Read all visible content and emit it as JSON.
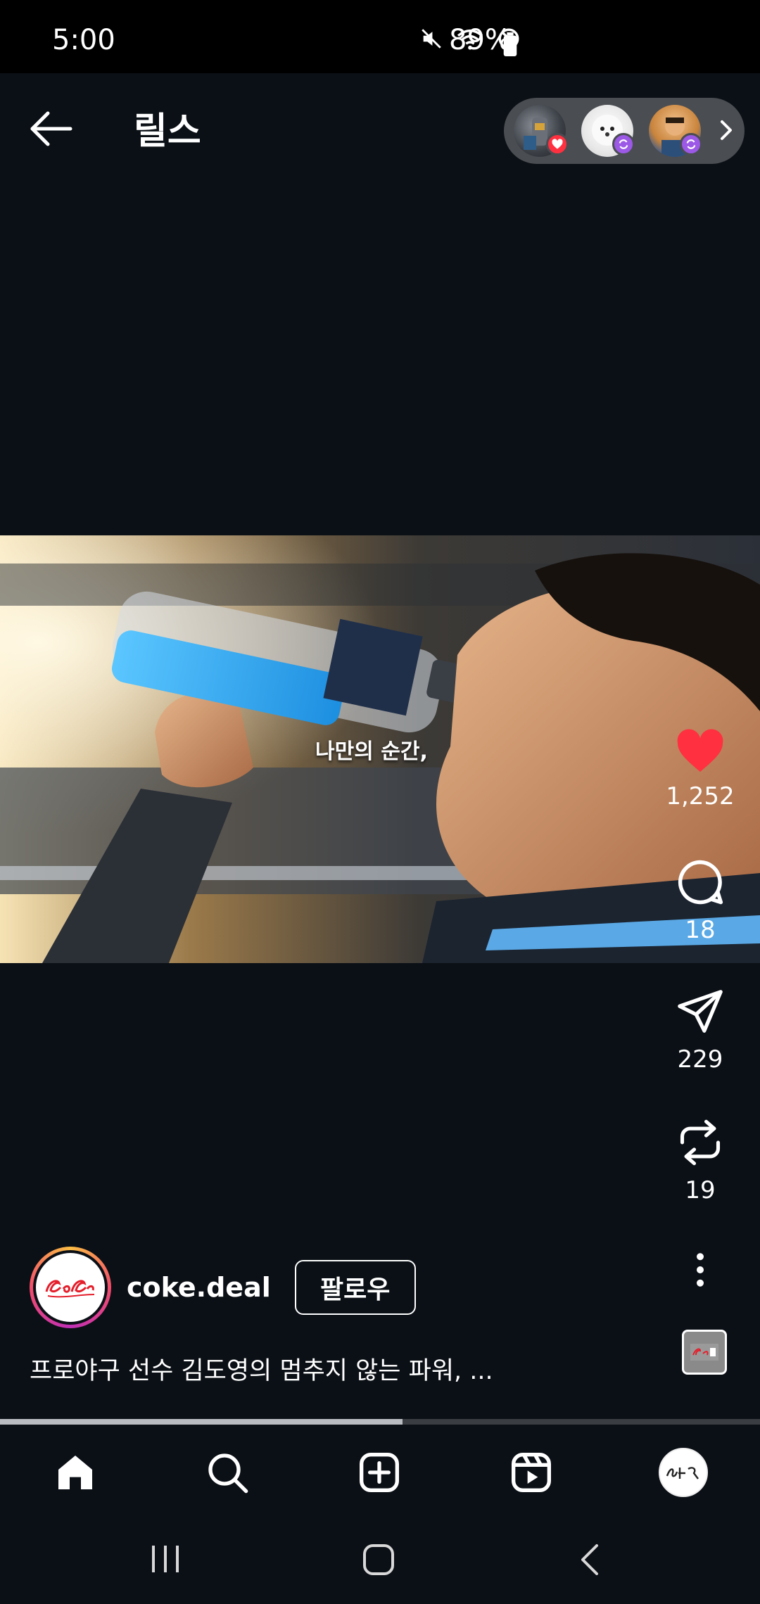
{
  "status_bar": {
    "time": "5:00",
    "battery_percent": "89%",
    "icons": [
      "mute-icon",
      "wifi-icon",
      "do-not-disturb-icon",
      "battery-icon"
    ]
  },
  "header": {
    "title": "릴스",
    "back_icon": "arrow-left-icon",
    "friends_pill": {
      "avatars": [
        "friend-avatar-1",
        "friend-avatar-2",
        "friend-avatar-3"
      ],
      "badges": [
        "heart-badge",
        "repost-badge",
        "repost-badge"
      ],
      "chevron_icon": "chevron-right-icon"
    }
  },
  "video": {
    "caption": "나만의 순간,"
  },
  "actions": {
    "like": {
      "icon": "heart-icon",
      "count": "1,252",
      "color": "#ff3040"
    },
    "comment": {
      "icon": "comment-icon",
      "count": "18"
    },
    "share": {
      "icon": "send-icon",
      "count": "229"
    },
    "repost": {
      "icon": "repost-icon",
      "count": "19"
    },
    "more": {
      "icon": "more-vertical-icon"
    }
  },
  "post": {
    "author": "coke.deal",
    "follow_label": "팔로우",
    "description": "프로야구 선수 김도영의 멈추지 않는 파워, ...",
    "progress": 0.53
  },
  "bottom_nav": [
    "home-icon",
    "search-icon",
    "create-icon",
    "reels-icon",
    "profile-avatar"
  ],
  "android_nav": [
    "recents-icon",
    "home-button-icon",
    "back-icon"
  ]
}
